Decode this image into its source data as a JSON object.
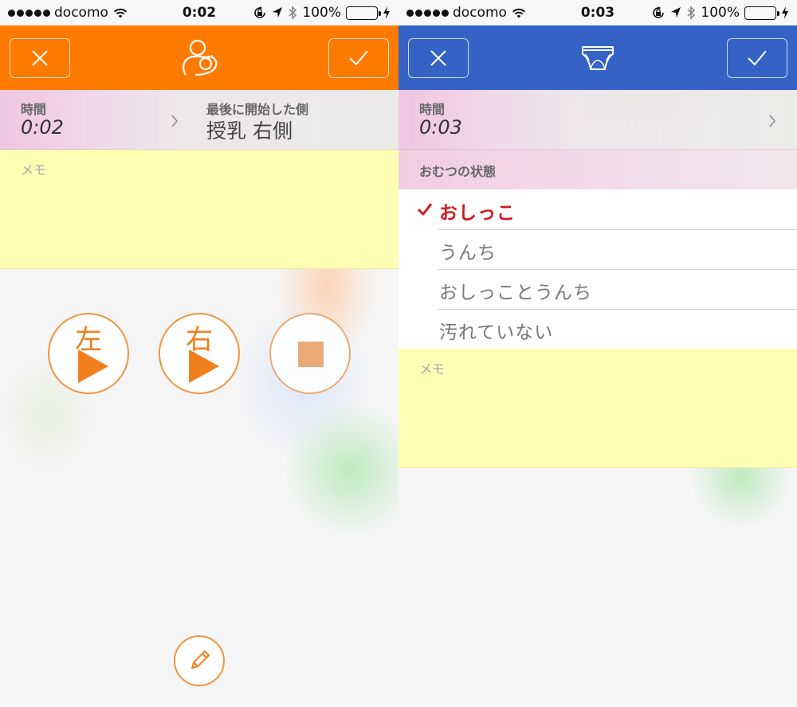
{
  "colors": {
    "left_header": "#ff7a00",
    "right_header": "#3563c5",
    "accent_orange": "#f07f1c",
    "selected_red": "#d0191e",
    "memo_yellow": "#fffdb4",
    "battery_green": "#3fd23a"
  },
  "left": {
    "status_bar": {
      "carrier": "docomo",
      "time": "0:02",
      "battery": "100%"
    },
    "nav": {
      "cancel_icon": "close-icon",
      "title_icon": "breastfeeding-icon",
      "confirm_icon": "checkmark-icon"
    },
    "time_label": "時間",
    "time_value": "0:02",
    "last_side_label": "最後に開始した側",
    "last_side_value": "授乳 右側",
    "memo_placeholder": "メモ",
    "buttons": {
      "left_label": "左",
      "right_label": "右",
      "stop_icon": "stop-icon",
      "edit_icon": "pencil-icon"
    }
  },
  "right": {
    "status_bar": {
      "carrier": "docomo",
      "time": "0:03",
      "battery": "100%"
    },
    "nav": {
      "cancel_icon": "close-icon",
      "title_icon": "diaper-icon",
      "confirm_icon": "checkmark-icon"
    },
    "time_label": "時間",
    "time_value": "0:03",
    "section_title": "おむつの状態",
    "options": [
      {
        "label": "おしっこ",
        "selected": true
      },
      {
        "label": "うんち",
        "selected": false
      },
      {
        "label": "おしっことうんち",
        "selected": false
      },
      {
        "label": "汚れていない",
        "selected": false
      }
    ],
    "memo_placeholder": "メモ"
  }
}
